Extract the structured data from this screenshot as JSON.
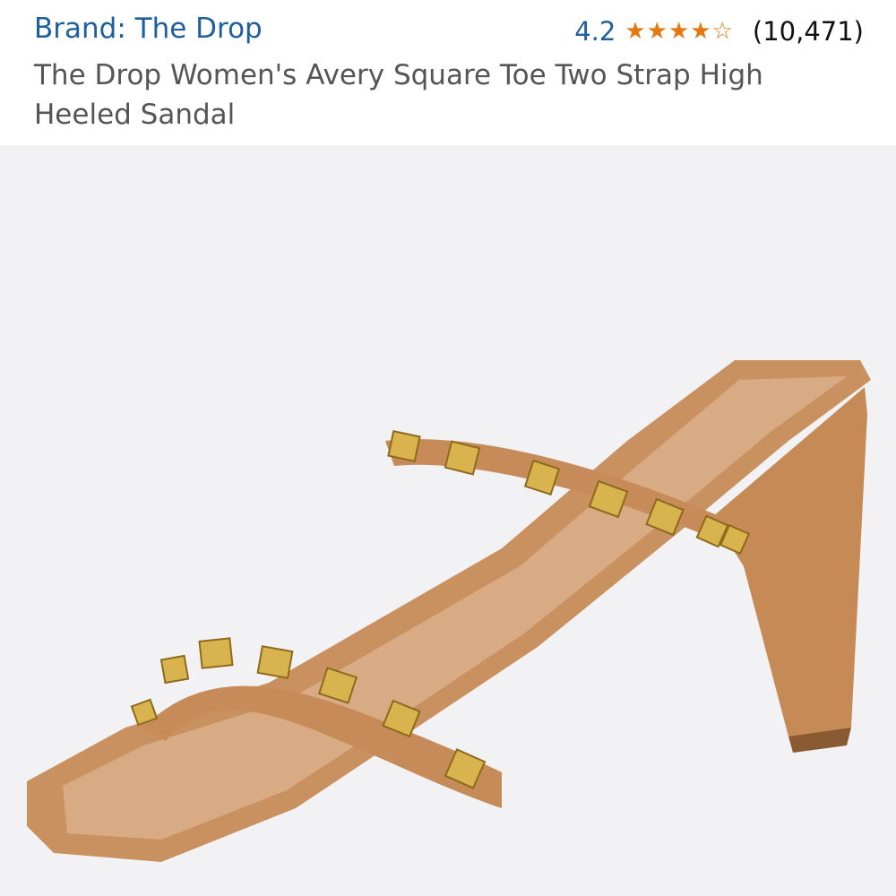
{
  "header": {
    "brand": "Brand: The Drop",
    "rating_value": "4.2",
    "rating_stars": 4.2,
    "review_count": "(10,471)",
    "title": "The Drop Women's Avery Square Toe Two Strap High Heeled Sandal"
  },
  "product_image": {
    "icon": "sandal-image",
    "colors": {
      "background": "#f2f1f3",
      "leather": "#c9915f",
      "insole": "#d8ab85",
      "stud": "#d9b34d"
    }
  },
  "icons": {
    "star_full": "★",
    "star_empty": "☆"
  }
}
